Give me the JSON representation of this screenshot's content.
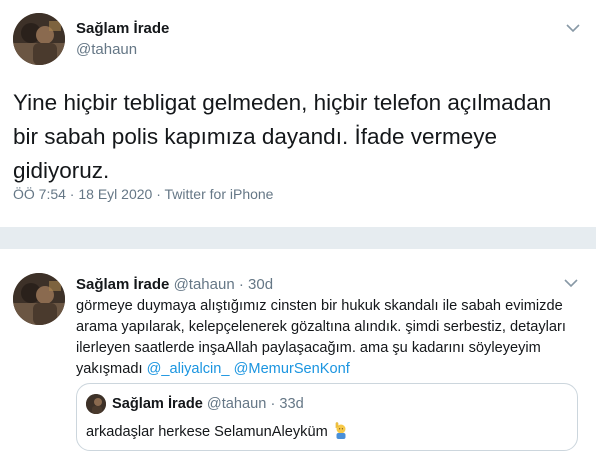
{
  "main_tweet": {
    "name": "Sağlam İrade",
    "handle": "@tahaun",
    "text_lines": [
      "Yine hiçbir tebligat gelmeden, hiçbir telefon açılmadan",
      "bir sabah polis kapımıza dayandı. İfade vermeye",
      "gidiyoruz."
    ],
    "time": "ÖÖ 7:54",
    "sep1": " · ",
    "date": "18 Eyl 2020",
    "sep2": " · ",
    "source": "Twitter for iPhone"
  },
  "reply_tweet": {
    "name": "Sağlam İrade",
    "handle": "@tahaun",
    "dot": "·",
    "age": "30d",
    "text_lines": [
      "görmeye duymaya alıştığımız cinsten bir hukuk skandalı ile sabah evimizde",
      "arama yapılarak, kelepçelenerek gözaltına alındık. şimdi serbestiz, detayları",
      "ilerleyen saatlerde inşaAllah paylaşacağım. ama şu kadarını söyleyeyim"
    ],
    "last_line_prefix": "yakışmadı ",
    "mention1": "@_aliyalcin_",
    "mention2": "@MemurSenKonf"
  },
  "quoted_tweet": {
    "name": "Sağlam İrade",
    "handle": "@tahaun",
    "dot": "·",
    "age": "33d",
    "text": "arkadaşlar herkese SelamunAleyküm",
    "emoji": "person-raising-hand-emoji"
  },
  "colors": {
    "link": "#1b95e0",
    "muted": "#657786",
    "text": "#14171a",
    "page_bg": "#e6ecf0"
  }
}
